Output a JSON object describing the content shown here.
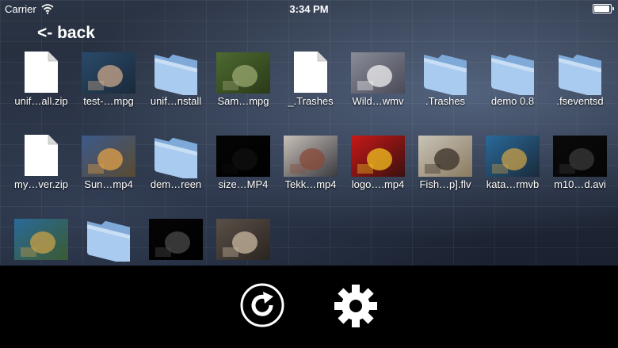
{
  "status_bar": {
    "carrier": "Carrier",
    "time": "3:34 PM",
    "battery_level": 0.95
  },
  "nav": {
    "back_label": "<- back"
  },
  "files": [
    {
      "name": "unif…all.zip",
      "kind": "file"
    },
    {
      "name": "test-…mpg",
      "kind": "video",
      "colors": [
        "#2a4a6a",
        "#c9a78a",
        "#1a2a3a"
      ]
    },
    {
      "name": "unif…nstall",
      "kind": "folder"
    },
    {
      "name": "Sam…mpg",
      "kind": "video",
      "colors": [
        "#4e6a30",
        "#9aa870",
        "#2a3a18"
      ]
    },
    {
      "name": "_.Trashes",
      "kind": "file"
    },
    {
      "name": "Wild…wmv",
      "kind": "video",
      "colors": [
        "#8a8c9a",
        "#f0f0f0",
        "#4a4a58"
      ]
    },
    {
      "name": ".Trashes",
      "kind": "folder"
    },
    {
      "name": "demo 0.8",
      "kind": "folder"
    },
    {
      "name": ".fseventsd",
      "kind": "folder"
    },
    {
      "name": "my…ver.zip",
      "kind": "file"
    },
    {
      "name": "Sun…mp4",
      "kind": "video",
      "colors": [
        "#3c5a8c",
        "#e0a048",
        "#5a4a30"
      ]
    },
    {
      "name": "dem…reen",
      "kind": "folder"
    },
    {
      "name": "size…MP4",
      "kind": "video",
      "colors": [
        "#050505",
        "#101010",
        "#000000"
      ]
    },
    {
      "name": "Tekk…mp4",
      "kind": "video",
      "colors": [
        "#c8c0b8",
        "#8a4a3a",
        "#3a3a40"
      ]
    },
    {
      "name": "logo….mp4",
      "kind": "video",
      "colors": [
        "#c81818",
        "#f0c020",
        "#3a1010"
      ]
    },
    {
      "name": "Fish…p].flv",
      "kind": "video",
      "colors": [
        "#c8c4b8",
        "#3a3028",
        "#8a7a60"
      ]
    },
    {
      "name": "kata…rmvb",
      "kind": "video",
      "colors": [
        "#2a6a9a",
        "#c8a048",
        "#1a2a3a"
      ]
    },
    {
      "name": "m10…d.avi",
      "kind": "video",
      "colors": [
        "#0a0a0a",
        "#3a3a3a",
        "#050505"
      ]
    },
    {
      "name": "",
      "kind": "video",
      "colors": [
        "#2a6a9a",
        "#c8a048",
        "#3a5a30"
      ]
    },
    {
      "name": "",
      "kind": "folder"
    },
    {
      "name": "",
      "kind": "video",
      "colors": [
        "#050505",
        "#4a4a4a",
        "#000000"
      ]
    },
    {
      "name": "",
      "kind": "video",
      "colors": [
        "#5a5048",
        "#c8b8a0",
        "#2a2420"
      ]
    }
  ],
  "toolbar": {
    "refresh_icon": "refresh-icon",
    "settings_icon": "gear-icon"
  }
}
